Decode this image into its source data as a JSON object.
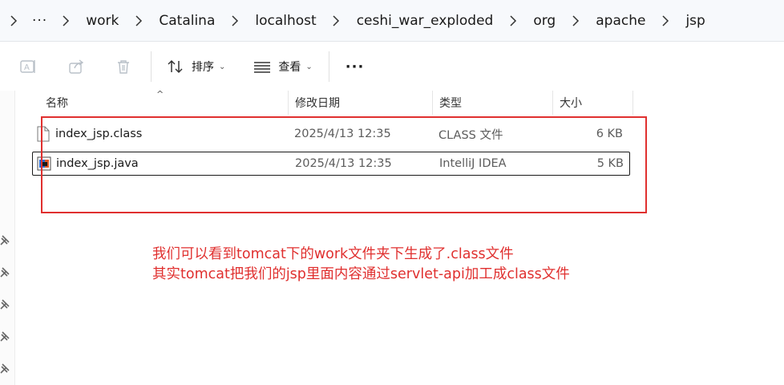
{
  "breadcrumb": {
    "ellipsis": "···",
    "items": [
      "work",
      "Catalina",
      "localhost",
      "ceshi_war_exploded",
      "org",
      "apache",
      "jsp"
    ]
  },
  "toolbar": {
    "sort_label": "排序",
    "view_label": "查看",
    "more_label": "···"
  },
  "columns": {
    "name": "名称",
    "date": "修改日期",
    "type": "类型",
    "size": "大小"
  },
  "files": [
    {
      "name": "index_jsp.class",
      "date": "2025/4/13 12:35",
      "type": "CLASS 文件",
      "size": "6 KB",
      "icon": "blank-file-icon"
    },
    {
      "name": "index_jsp.java",
      "date": "2025/4/13 12:35",
      "type": "IntelliJ IDEA",
      "size": "5 KB",
      "icon": "java-file-icon"
    }
  ],
  "annotation": {
    "line1": "我们可以看到tomcat下的work文件夹下生成了.class文件",
    "line2": "其实tomcat把我们的jsp里面内容通过servlet-api加工成class文件",
    "color": "#e0302f"
  }
}
